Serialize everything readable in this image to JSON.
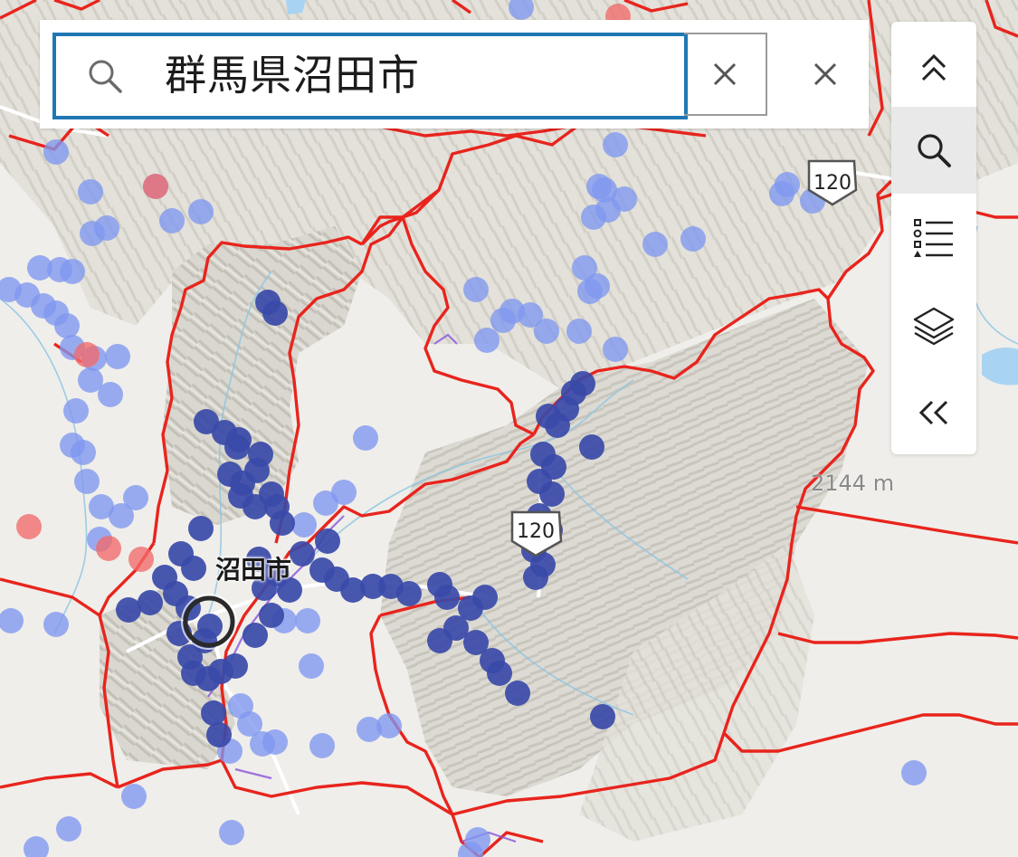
{
  "search": {
    "query": "群馬県沼田市",
    "search_icon": "search-icon",
    "clear_icon": "close-icon",
    "close_icon": "close-icon"
  },
  "toolbar": {
    "items": [
      {
        "icon": "chevron-double-up-icon",
        "active": false
      },
      {
        "icon": "search-icon",
        "active": true
      },
      {
        "icon": "legend-list-icon",
        "active": false
      },
      {
        "icon": "layers-icon",
        "active": false
      },
      {
        "icon": "chevron-double-left-icon",
        "active": false
      }
    ]
  },
  "map": {
    "city_label": "沼田市",
    "elevation_label": "2144 m",
    "road_shields": [
      "120",
      "120"
    ],
    "colors": {
      "boundary": "#e8241d",
      "marker_dark": "#3a4aa8",
      "marker_light": "#7f97f0",
      "marker_red": "#f26a6a",
      "highway": "#ffffff"
    }
  }
}
